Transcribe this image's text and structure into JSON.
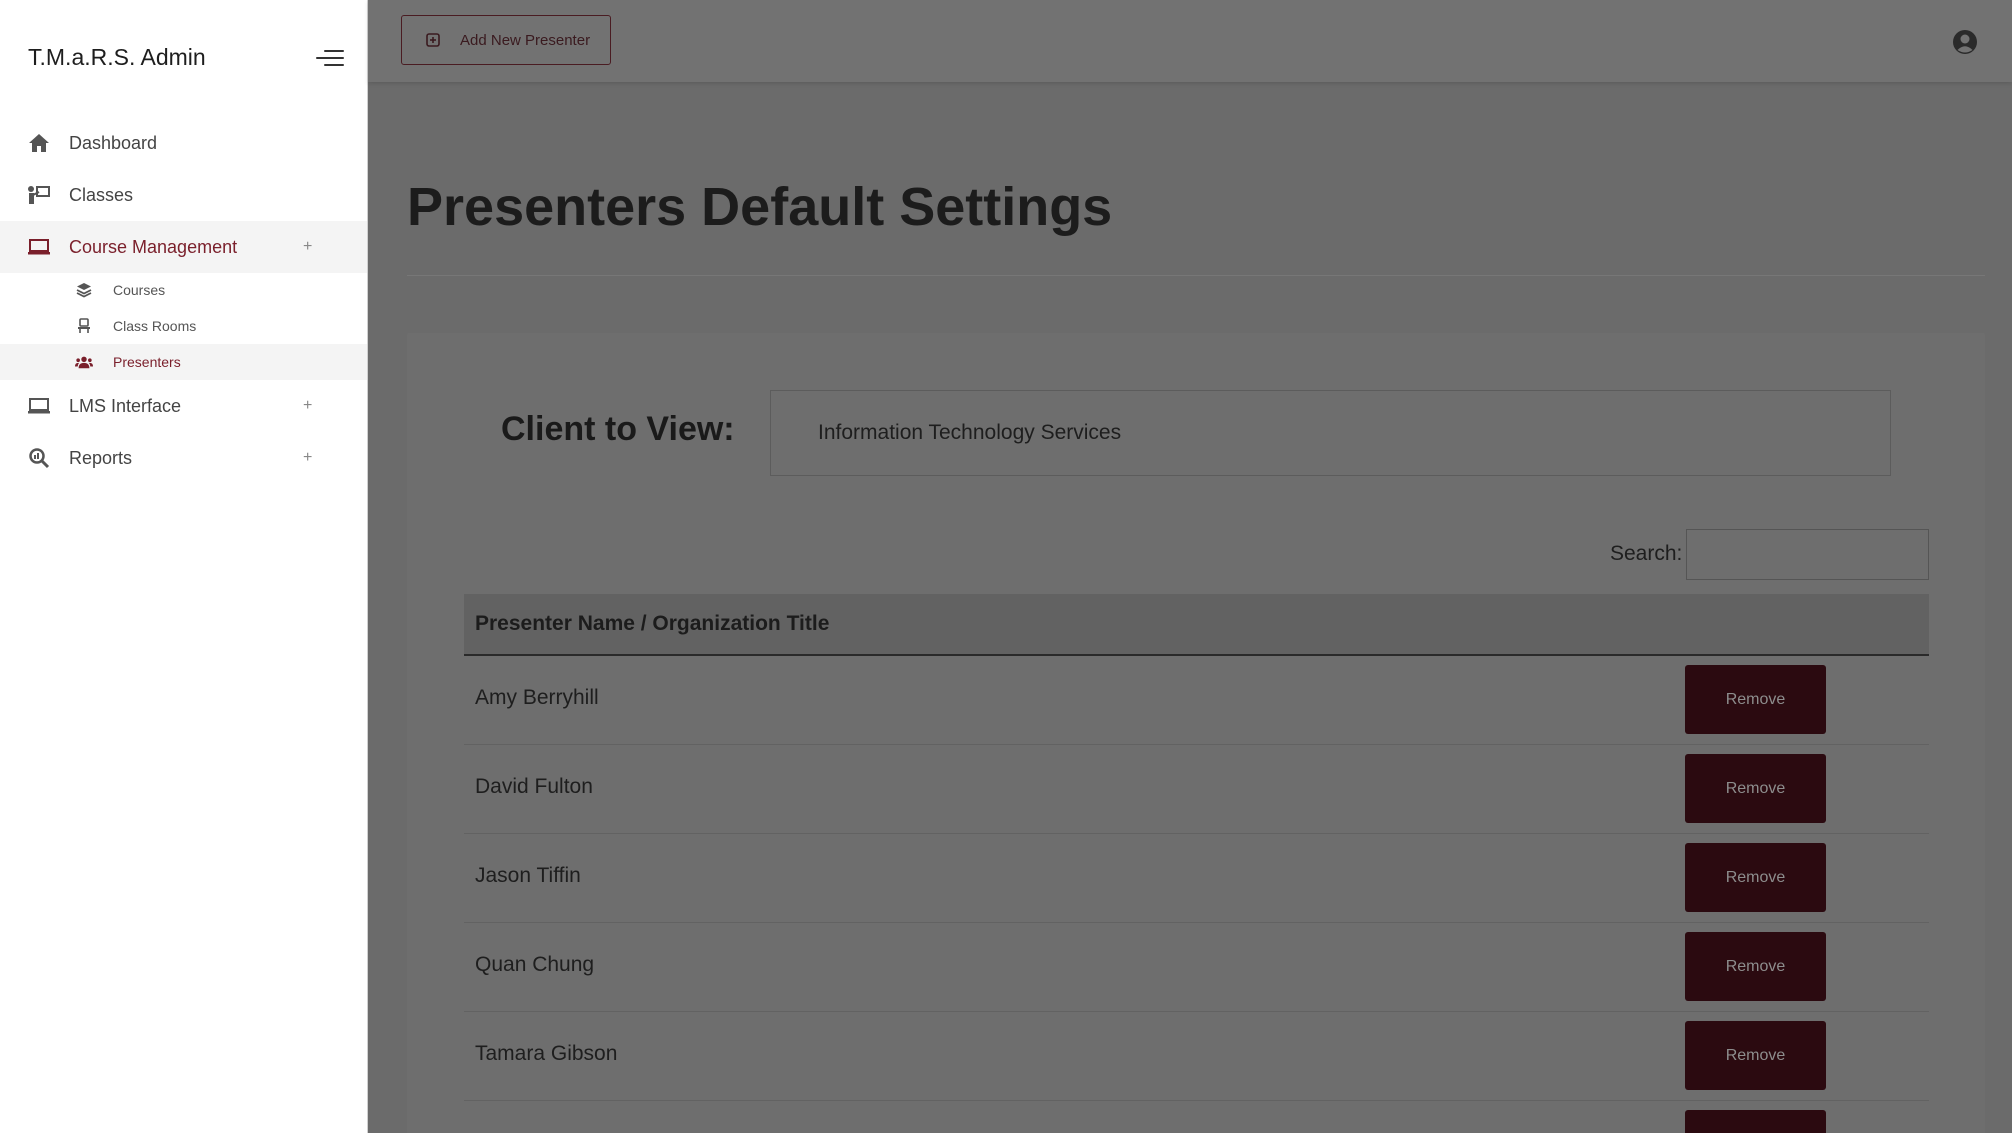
{
  "app": {
    "title": "T.M.a.R.S. Admin"
  },
  "sidebar": {
    "items": [
      {
        "label": "Dashboard",
        "icon": "home-icon"
      },
      {
        "label": "Classes",
        "icon": "presenter-board-icon"
      },
      {
        "label": "Course Management",
        "icon": "laptop-icon",
        "expand": "+"
      },
      {
        "label": "LMS Interface",
        "icon": "laptop-icon",
        "expand": "+"
      },
      {
        "label": "Reports",
        "icon": "magnify-icon",
        "expand": "+"
      }
    ],
    "subitems": [
      {
        "label": "Courses",
        "icon": "layers-icon"
      },
      {
        "label": "Class Rooms",
        "icon": "chair-icon"
      },
      {
        "label": "Presenters",
        "icon": "users-icon"
      }
    ]
  },
  "toolbar": {
    "add_label": "Add New Presenter"
  },
  "main": {
    "title": "Presenters Default Settings",
    "client_label": "Client to View:",
    "client_value": "Information Technology Services",
    "search_label": "Search:",
    "search_value": "",
    "table_header": "Presenter Name / Organization Title",
    "rows": [
      {
        "name": "Amy Berryhill",
        "action": "Remove"
      },
      {
        "name": "David Fulton",
        "action": "Remove"
      },
      {
        "name": "Jason Tiffin",
        "action": "Remove"
      },
      {
        "name": "Quan Chung",
        "action": "Remove"
      },
      {
        "name": "Tamara Gibson",
        "action": "Remove"
      },
      {
        "name": "",
        "action": ""
      }
    ]
  },
  "colors": {
    "accent": "#7a1f2b",
    "button": "#2b0a10",
    "overlay": "#6b6b6b"
  }
}
